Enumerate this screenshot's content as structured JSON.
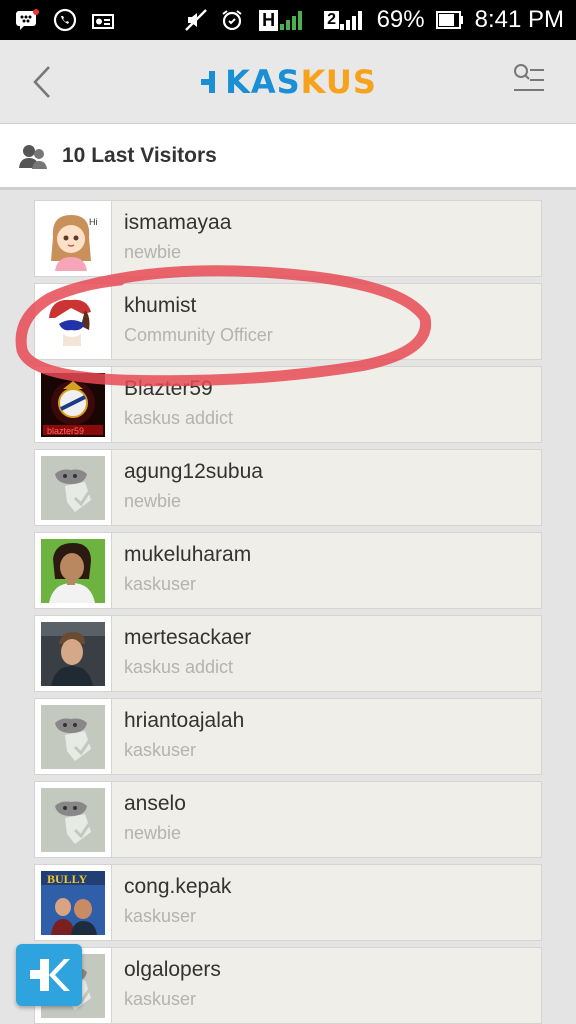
{
  "status_bar": {
    "battery": "69%",
    "time": "8:41 PM",
    "network_h": "H",
    "sim2": "2"
  },
  "header": {
    "logo_part1": "KAS",
    "logo_part2": "KUS"
  },
  "section": {
    "title": "10 Last Visitors"
  },
  "visitors": [
    {
      "name": "ismamayaa",
      "rank": "newbie",
      "avatar": "girl-avatar"
    },
    {
      "name": "khumist",
      "rank": "Community Officer",
      "avatar": "cartoon-avatar"
    },
    {
      "name": "Blazter59",
      "rank": "kaskus addict",
      "avatar": "real-madrid-avatar"
    },
    {
      "name": "agung12subua",
      "rank": "newbie",
      "avatar": "default-avatar"
    },
    {
      "name": "mukeluharam",
      "rank": "kaskuser",
      "avatar": "photo-avatar"
    },
    {
      "name": "mertesackaer",
      "rank": "kaskus addict",
      "avatar": "photo-avatar"
    },
    {
      "name": "hriantoajalah",
      "rank": "kaskuser",
      "avatar": "default-avatar"
    },
    {
      "name": "anselo",
      "rank": "newbie",
      "avatar": "default-avatar"
    },
    {
      "name": "cong.kepak",
      "rank": "kaskuser",
      "avatar": "bully-game-avatar"
    },
    {
      "name": "olgalopers",
      "rank": "kaskuser",
      "avatar": "default-avatar"
    }
  ],
  "colors": {
    "brand_blue": "#1a8fd6",
    "brand_orange": "#f7a21b",
    "annotation_red": "#e84a55"
  }
}
